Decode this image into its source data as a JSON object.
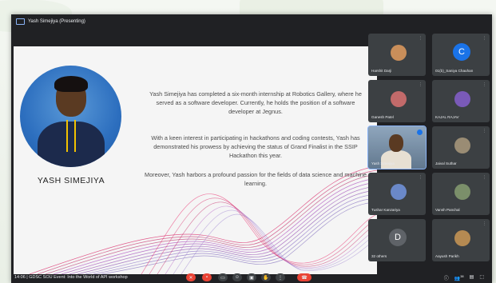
{
  "window": {
    "presenter_label": "Yash Simejiya (Presenting)"
  },
  "slide": {
    "person_name": "YASH SIMEJIYA",
    "paragraphs": [
      "Yash Simejiya has completed a six-month internship at Robotics Gallery, where he served as a software developer. Currently, he holds the position of a software developer at Jegnus.",
      "With a keen interest in participating in hackathons and coding contests, Yash has demonstrated his prowess by achieving the status of Grand Finalist in the SSIP Hackathon this year.",
      "Moreover, Yash harbors a profound passion for the fields of data science and machine learning."
    ]
  },
  "participants": [
    {
      "name": "Harshit Darji",
      "avatar_color": "#c98e5a"
    },
    {
      "name": "01(b)_Saniya Chauhan",
      "letter": "C",
      "avatar_color": "#1a73e8"
    },
    {
      "name": "Ganesh Patel",
      "avatar_color": "#c26a6a"
    },
    {
      "name": "KAJAL RAJAV",
      "avatar_color": "#7a5ab8"
    },
    {
      "name": "Yash Simejiya",
      "active": true
    },
    {
      "name": "Jaival Suthar",
      "avatar_color": "#9a8c74"
    },
    {
      "name": "Tushar Kanzariya",
      "avatar_color": "#6a88c8"
    },
    {
      "name": "Vansh Panchal",
      "avatar_color": "#7b8f6a"
    },
    {
      "name": "32 others",
      "letter": "D",
      "avatar_color": "#5f6368"
    },
    {
      "name": "Aayush Parikh",
      "avatar_color": "#b58a52"
    }
  ],
  "bottombar": {
    "meeting_text": "14:06 | GDSC SOU Event: Into the World of API workshop",
    "participant_count": "38"
  },
  "colors": {
    "accent": "#8ab4f8",
    "danger": "#ea4335",
    "dark": "#202124",
    "tile": "#3c4043"
  }
}
